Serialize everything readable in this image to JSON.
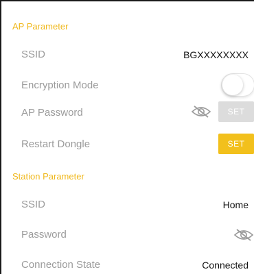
{
  "ap_section": {
    "header": "AP Parameter",
    "ssid": {
      "label": "SSID",
      "value": "BGXXXXXXXX"
    },
    "encryption": {
      "label": "Encryption Mode",
      "enabled": false
    },
    "password": {
      "label": "AP Password",
      "button": "SET",
      "icon": "eye-off-icon"
    },
    "restart": {
      "label": "Restart Dongle",
      "button": "SET"
    }
  },
  "station_section": {
    "header": "Station Parameter",
    "ssid": {
      "label": "SSID",
      "value": "Home"
    },
    "password": {
      "label": "Password",
      "icon": "eye-off-icon"
    },
    "connection": {
      "label": "Connection State",
      "value": "Connected"
    }
  },
  "colors": {
    "accent": "#f0b81c",
    "label": "#9b9b9b",
    "value": "#111111",
    "button_disabled": "#dcdcdc",
    "button_active": "#f2c01c"
  }
}
